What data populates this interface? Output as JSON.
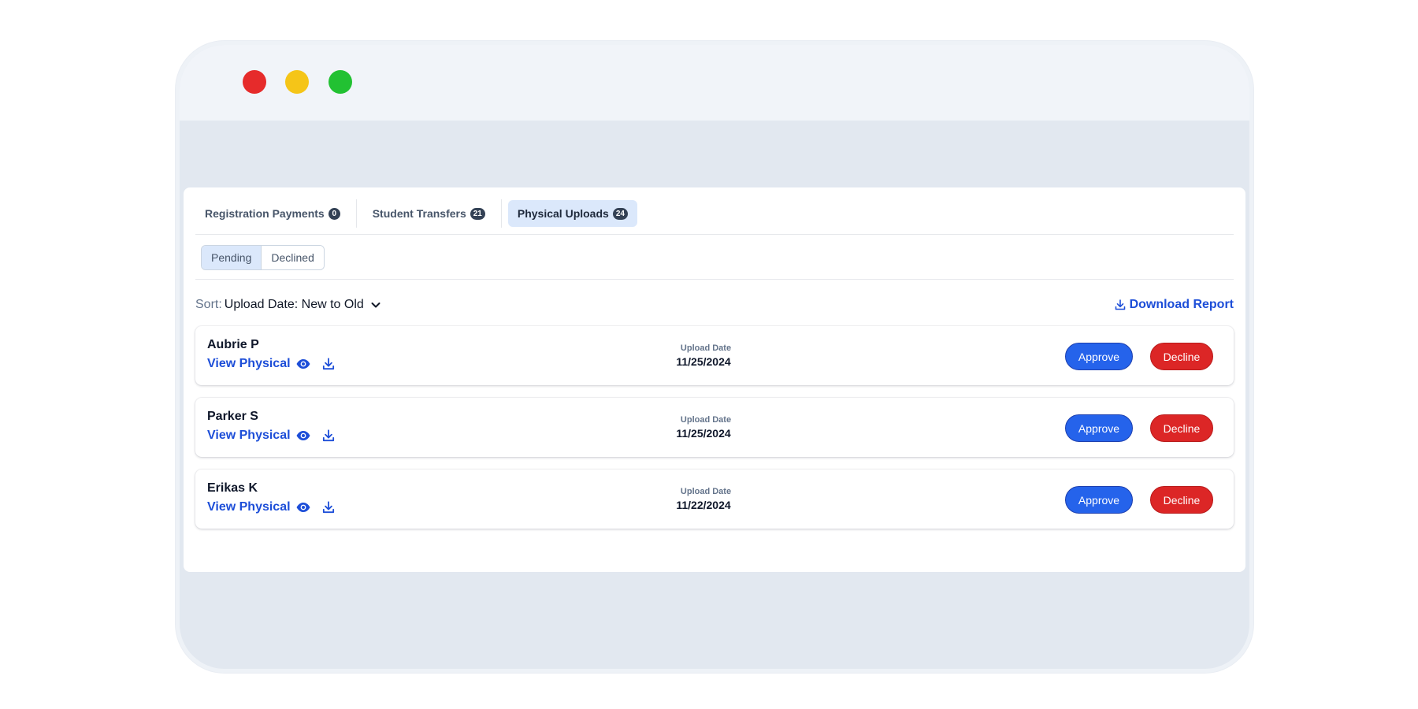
{
  "window": {
    "controls": [
      "close",
      "minimize",
      "maximize"
    ]
  },
  "tabs": [
    {
      "label": "Registration Payments",
      "count": "0",
      "active": false
    },
    {
      "label": "Student Transfers",
      "count": "21",
      "active": false
    },
    {
      "label": "Physical Uploads",
      "count": "24",
      "active": true
    }
  ],
  "filters": {
    "pending": "Pending",
    "declined": "Declined",
    "active": "Pending"
  },
  "sort": {
    "label": "Sort:",
    "value": "Upload Date: New to Old"
  },
  "download_report": "Download Report",
  "records": [
    {
      "name": "Aubrie P",
      "link": "View Physical",
      "date_label": "Upload Date",
      "date": "11/25/2024",
      "approve": "Approve",
      "decline": "Decline"
    },
    {
      "name": "Parker S",
      "link": "View Physical",
      "date_label": "Upload Date",
      "date": "11/25/2024",
      "approve": "Approve",
      "decline": "Decline"
    },
    {
      "name": "Erikas K",
      "link": "View Physical",
      "date_label": "Upload Date",
      "date": "11/22/2024",
      "approve": "Approve",
      "decline": "Decline"
    }
  ],
  "icons": {
    "view": "eye-icon",
    "download": "download-icon",
    "sort": "chevron-down-icon"
  },
  "colors": {
    "accent": "#1d4ed8",
    "approve": "#2563eb",
    "decline": "#dc2626",
    "active_tab_bg": "#dbe8fb"
  }
}
